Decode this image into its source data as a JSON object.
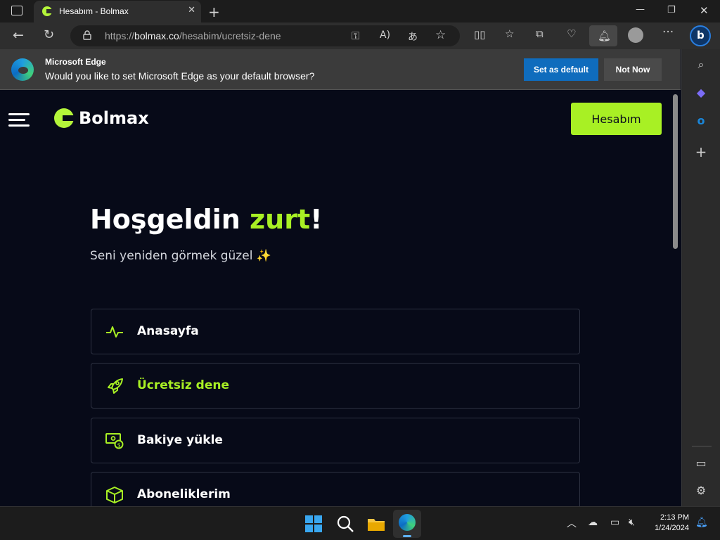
{
  "tab": {
    "title": "Hesabım - Bolmax"
  },
  "address": {
    "prefix": "https://",
    "domain": "bolmax.co",
    "path": "/hesabim/ucretsiz-dene"
  },
  "notification": {
    "title": "Microsoft Edge",
    "message": "Would you like to set Microsoft Edge as your default browser?",
    "primary_label": "Set as default",
    "secondary_label": "Not Now"
  },
  "site": {
    "brand": "Bolmax",
    "account_button": "Hesabım",
    "greeting_prefix": "Hoşgeldin ",
    "greeting_name": "zurt",
    "greeting_suffix": "!",
    "subtitle": "Seni yeniden görmek güzel ✨",
    "menu": [
      {
        "label": "Anasayfa",
        "icon": "activity-icon",
        "active": false
      },
      {
        "label": "Ücretsiz dene",
        "icon": "rocket-icon",
        "active": true
      },
      {
        "label": "Bakiye yükle",
        "icon": "money-icon",
        "active": false
      },
      {
        "label": "Aboneliklerim",
        "icon": "box-icon",
        "active": false
      }
    ],
    "accent": "#a8f024",
    "background": "#070a18"
  },
  "taskbar": {
    "time": "2:13 PM",
    "date": "1/24/2024"
  }
}
